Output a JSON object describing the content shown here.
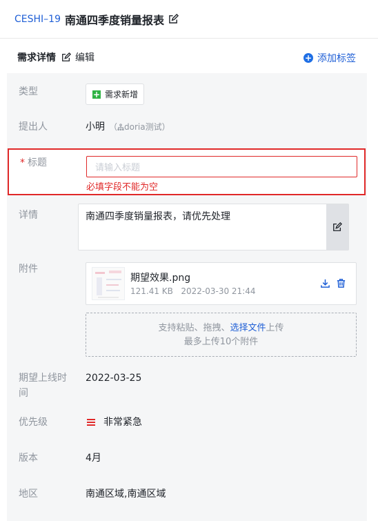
{
  "header": {
    "ticket_id": "CESHI–19",
    "title": "南通四季度销量报表"
  },
  "section": {
    "title": "需求详情",
    "edit_label": "编辑",
    "add_tag_label": "添加标签"
  },
  "fields": {
    "type": {
      "label": "类型",
      "value": "需求新增"
    },
    "submitter": {
      "label": "提出人",
      "name": "小明",
      "org_prefix": "（",
      "org": "doria测试",
      "org_suffix": "）"
    },
    "title": {
      "label": "标题",
      "required_mark": "*",
      "placeholder": "请输入标题",
      "error": "必填字段不能为空"
    },
    "detail": {
      "label": "详情",
      "value": "南通四季度销量报表，请优先处理"
    },
    "attachment": {
      "label": "附件",
      "file_name": "期望效果.png",
      "file_size": "121.41 KB",
      "uploaded_at": "2022-03-30 21:44",
      "upload_hint_prefix": "支持粘贴、拖拽、",
      "upload_link": "选择文件",
      "upload_hint_suffix": "上传",
      "upload_limit": "最多上传10个附件"
    },
    "expected_date": {
      "label_line1": "期望上线时",
      "label_line2": "间",
      "value": "2022-03-25"
    },
    "priority": {
      "label": "优先级",
      "value": "非常紧急",
      "color": "#e02828"
    },
    "version": {
      "label": "版本",
      "value": "4月"
    },
    "region": {
      "label": "地区",
      "value": "南通区域,南通区域"
    }
  },
  "colors": {
    "accent": "#1f5fd6",
    "error": "#e02828",
    "success": "#2fb344"
  }
}
